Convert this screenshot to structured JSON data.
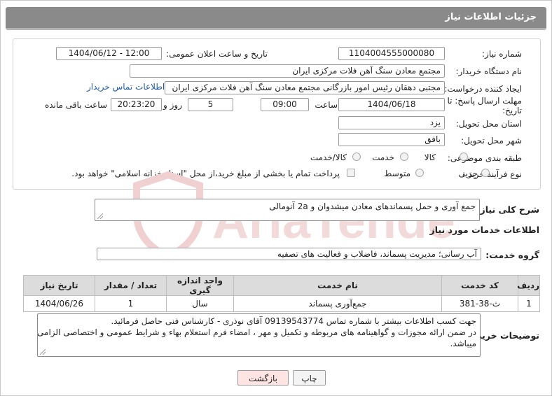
{
  "header": {
    "title": "جزئیات اطلاعات نیاز"
  },
  "form": {
    "need_number_label": "شماره نیاز:",
    "need_number": "1104004555000080",
    "announce_label": "تاریخ و ساعت اعلان عمومی:",
    "announce_value": "1404/06/12 - 12:00",
    "buyer_org_label": "نام دستگاه خریدار:",
    "buyer_org": "مجتمع معادن سنگ آهن فلات مرکزی ایران",
    "creator_label": "ایجاد کننده درخواست:",
    "creator": "مجتبی  دهقان رئیس امور بازرگانی مجتمع معادن سنگ آهن فلات مرکزی ایران",
    "buyer_contact_link": "اطلاعات تماس خریدار",
    "deadline_label_1": "مهلت ارسال پاسخ: تا",
    "deadline_label_2": "تاریخ:",
    "deadline_date": "1404/06/18",
    "time_label": "ساعت",
    "deadline_time": "09:00",
    "days_value": "5",
    "days_label": "روز و",
    "remaining_time": "20:23:20",
    "remaining_label": "ساعت باقی مانده",
    "province_label": "استان محل تحویل:",
    "province": "یزد",
    "city_label": "شهر محل تحویل:",
    "city": "بافق",
    "category_label": "طبقه بندی موضوعی:",
    "category_options": [
      "کالا",
      "خدمت",
      "کالا/خدمت"
    ],
    "process_label": "نوع فرآیند خرید :",
    "process_options": [
      "جزیی",
      "متوسط"
    ],
    "payment_note": "پرداخت تمام یا بخشی از مبلغ خرید،از محل \"اسناد خزانه اسلامی\" خواهد بود."
  },
  "summary": {
    "label": "شرح کلی نیاز:",
    "text": "جمع آوری و حمل پسماندهای معادن میشدوان و 2a آنومالی"
  },
  "services": {
    "section_title": "اطلاعات خدمات مورد نیاز",
    "group_label": "گروه خدمت:",
    "group_value": "آب رسانی؛ مدیریت پسماند، فاضلاب و فعالیت های تصفیه"
  },
  "table": {
    "headers": [
      "ردیف",
      "کد خدمت",
      "نام خدمت",
      "واحد اندازه گیری",
      "تعداد / مقدار",
      "تاریخ نیاز"
    ],
    "rows": [
      [
        "1",
        "ث-38-381",
        "جمع‌آوری پسماند",
        "سال",
        "1",
        "1404/06/26"
      ]
    ]
  },
  "buyer_notes": {
    "label": "توضیحات خریدار:",
    "line1": "جهت کسب اطلاعات بیشتر با شماره تماس 09139543774 آقای نوذری - کارشناس فنی حاصل فرمائید.",
    "line2": "در ضمن ارائه مجوزات و گواهینامه های مربوطه و تکمیل و مهر ، امضاء فرم استعلام بهاء و شرایط عمومی و اختصاصی الزامی",
    "line3": "میباشد."
  },
  "buttons": {
    "print": "چاپ",
    "back": "بازگشت"
  },
  "watermark": {
    "text": "AriaTender.net"
  },
  "colors": {
    "header_bg": "#8a8a8a",
    "link": "#1e5aa8",
    "back_button": "#ffe4e4",
    "watermark": "#f0d0d0"
  }
}
